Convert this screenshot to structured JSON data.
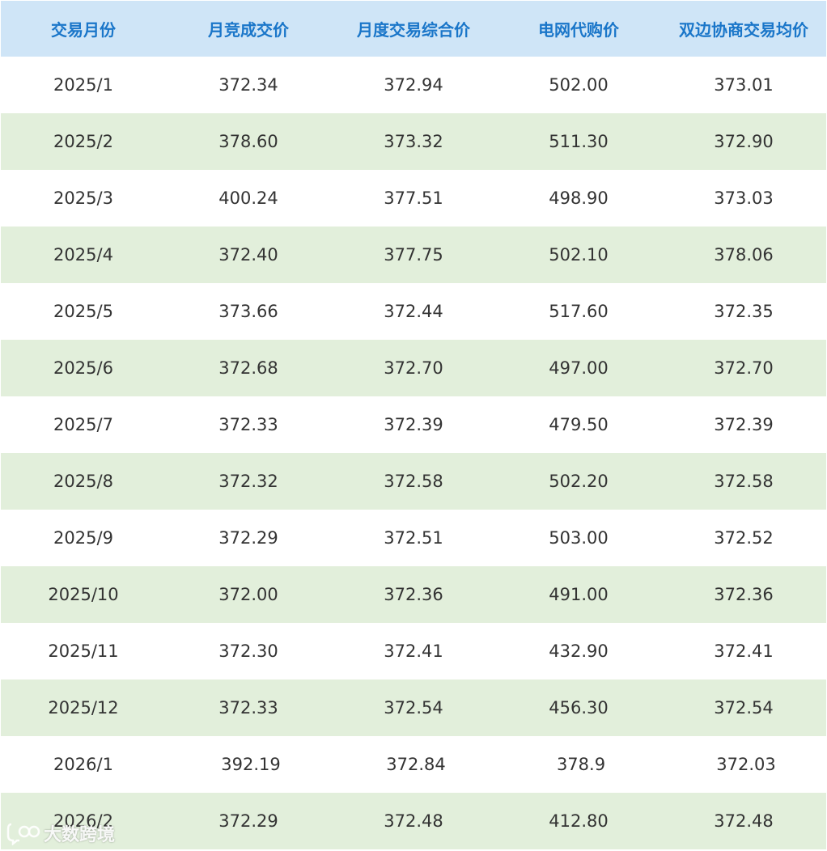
{
  "table": {
    "headers": [
      "交易月份",
      "月竞成交价",
      "月度交易综合价",
      "电网代购价",
      "双边协商交易均价"
    ],
    "rows": [
      [
        "2025/1",
        "372.34",
        "372.94",
        "502.00",
        "373.01"
      ],
      [
        "2025/2",
        "378.60",
        "373.32",
        "511.30",
        "372.90"
      ],
      [
        "2025/3",
        "400.24",
        "377.51",
        "498.90",
        "373.03"
      ],
      [
        "2025/4",
        "372.40",
        "377.75",
        "502.10",
        "378.06"
      ],
      [
        "2025/5",
        "373.66",
        "372.44",
        "517.60",
        "372.35"
      ],
      [
        "2025/6",
        "372.68",
        "372.70",
        "497.00",
        "372.70"
      ],
      [
        "2025/7",
        "372.33",
        "372.39",
        "479.50",
        "372.39"
      ],
      [
        "2025/8",
        "372.32",
        "372.58",
        "502.20",
        "372.58"
      ],
      [
        "2025/9",
        "372.29",
        "372.51",
        "503.00",
        "372.52"
      ],
      [
        "2025/10",
        "372.00",
        "372.36",
        "491.00",
        "372.36"
      ],
      [
        "2025/11",
        "372.30",
        "372.41",
        "432.90",
        "372.41"
      ],
      [
        "2025/12",
        "372.33",
        "372.54",
        "456.30",
        "372.54"
      ],
      [
        "2026/1",
        "392.19",
        "372.84",
        "378.9",
        "372.03"
      ],
      [
        "2026/2",
        "372.29",
        "372.48",
        "412.80",
        "372.48"
      ]
    ]
  },
  "watermark": {
    "text": "大数跨境",
    "icon": "chat-bubble-logo-icon"
  },
  "colors": {
    "header_bg": "#cfe5f7",
    "header_text": "#1a76c9",
    "row_alt_bg": "#e2efdb",
    "cell_text": "#333333"
  }
}
